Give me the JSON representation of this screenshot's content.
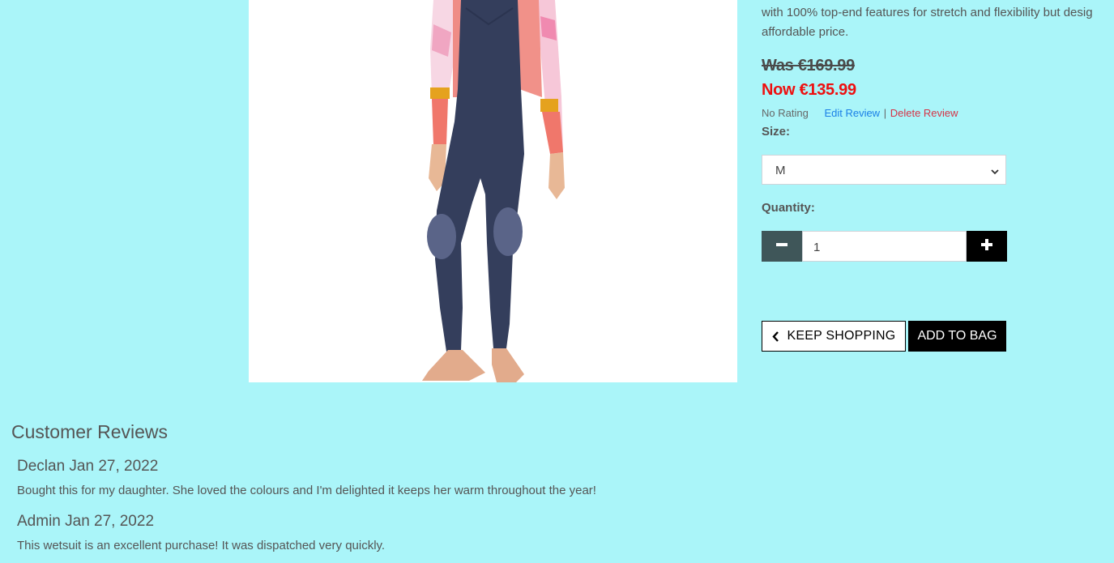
{
  "product": {
    "description_line1": "with 100% top-end features for stretch and flexibility but desig",
    "description_line2": "affordable price.",
    "price_was": "Was €169.99",
    "price_now": "Now €135.99",
    "rating": "No Rating",
    "edit_review": "Edit Review",
    "separator": "|",
    "delete_review": "Delete Review",
    "size_label": "Size:",
    "size_selected": "M",
    "quantity_label": "Quantity:",
    "quantity_value": "1",
    "keep_shopping": "KEEP SHOPPING",
    "add_to_bag": "ADD TO BAG"
  },
  "reviews": {
    "heading": "Customer Reviews",
    "items": [
      {
        "author_date": "Declan Jan 27, 2022",
        "text": "Bought this for my daughter. She loved the colours and I'm delighted it keeps her warm throughout the year!"
      },
      {
        "author_date": "Admin Jan 27, 2022",
        "text": "This wetsuit is an excellent purchase! It was dispatched very quickly."
      }
    ]
  },
  "icons": {
    "select": "chevron-down-icon",
    "minus": "minus-icon",
    "plus": "plus-icon",
    "back": "chevron-left-icon"
  },
  "colors": {
    "background": "#aaf5f9",
    "price_now": "#ee0f0f",
    "edit_link": "#1a7fe6",
    "delete_link": "#d63346",
    "minus_button": "#3f5659",
    "plus_button": "#000000"
  }
}
